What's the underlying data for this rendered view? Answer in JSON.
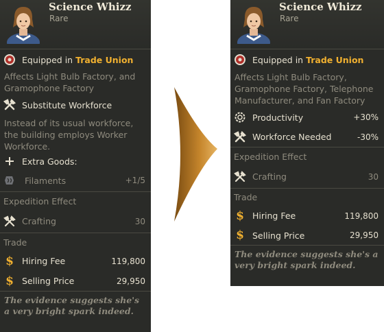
{
  "left_card": {
    "title": "Science Whizz",
    "rarity": "Rare",
    "equipped_prefix": "Equipped in",
    "equipped_building": "Trade Union",
    "affects": "Affects Light Bulb Factory, and Gramophone Factory",
    "ability_title": "Substitute Workforce",
    "ability_desc": "Instead of its usual workforce, the building employs Worker Workforce.",
    "extra_goods_label": "Extra Goods:",
    "extra_goods_item": "Filaments",
    "extra_goods_value": "+1/5",
    "expedition_title": "Expedition Effect",
    "crafting_label": "Crafting",
    "crafting_value": "30",
    "trade_title": "Trade",
    "hiring_fee_label": "Hiring Fee",
    "hiring_fee_value": "119,800",
    "selling_price_label": "Selling Price",
    "selling_price_value": "29,950",
    "quote": "The evidence suggests she's a very bright spark indeed."
  },
  "right_card": {
    "title": "Science Whizz",
    "rarity": "Rare",
    "equipped_prefix": "Equipped in",
    "equipped_building": "Trade Union",
    "affects": "Affects Light Bulb Factory, Gramophone Factory, Telephone Manufacturer, and Fan Factory",
    "productivity_label": "Productivity",
    "productivity_value": "+30%",
    "workforce_label": "Workforce Needed",
    "workforce_value": "-30%",
    "expedition_title": "Expedition Effect",
    "crafting_label": "Crafting",
    "crafting_value": "30",
    "trade_title": "Trade",
    "hiring_fee_label": "Hiring Fee",
    "hiring_fee_value": "119,800",
    "selling_price_label": "Selling Price",
    "selling_price_value": "29,950",
    "quote": "The evidence suggests she's a very bright spark indeed."
  },
  "icons": {
    "portrait": "character-portrait-icon",
    "union": "union-badge-icon",
    "tools": "hammer-wrench-icon",
    "plus": "plus-icon",
    "filament": "filament-icon",
    "gear": "productivity-gear-icon",
    "dollar": "dollar-icon",
    "arrow": "arrow-right-icon"
  },
  "colors": {
    "accent": "#f0b030",
    "background": "#2a2b28",
    "text": "#e6e0cf",
    "muted": "#8f8b7e"
  }
}
